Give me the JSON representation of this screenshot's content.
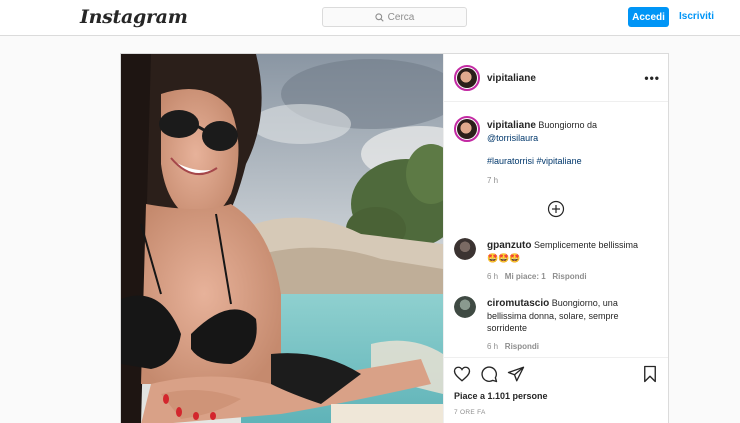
{
  "nav": {
    "logo": "Instagram",
    "search_placeholder": "Cerca",
    "login_label": "Accedi",
    "signup_label": "Iscriviti"
  },
  "post": {
    "author": "vipitaliane",
    "more_label": "•••",
    "caption": {
      "username": "vipitaliane",
      "text": "Buongiorno da",
      "mention": "@torrisilaura",
      "hashtags": [
        "#lauratorrisi",
        "#vipitaliane"
      ],
      "time": "7 h"
    },
    "comments": [
      {
        "username": "gpanzuto",
        "text": "Semplicemente bellissima",
        "emoji": "🤩🤩🤩",
        "time": "6 h",
        "likes": "Mi piace: 1",
        "reply": "Rispondi"
      },
      {
        "username": "ciromutascio",
        "text_lines": [
          "Buongiorno, una",
          "bellissima donna, solare, sempre",
          "sorridente"
        ],
        "time": "6 h",
        "reply": "Rispondi"
      }
    ],
    "likes_text": "Piace a 1.101 persone",
    "time_ago": "7 ORE FA"
  },
  "icons": {
    "search": "search-icon",
    "add_comments": "plus-circle-icon",
    "like": "heart-icon",
    "comment": "comment-icon",
    "share": "paper-plane-icon",
    "save": "bookmark-icon",
    "more": "more-options-icon"
  },
  "colors": {
    "accent": "#0095f6",
    "link": "#00376b",
    "story_ring": "#c32aa3",
    "meta_gray": "#8e8e8e"
  }
}
